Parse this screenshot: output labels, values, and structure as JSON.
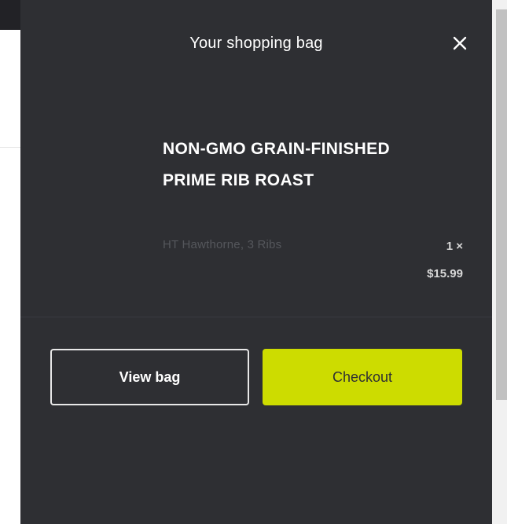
{
  "drawer": {
    "title": "Your shopping bag",
    "close_icon": "close-icon",
    "colors": {
      "background": "#2e2f33",
      "accent": "#cddc00",
      "text": "#ffffff",
      "muted": "#55575c"
    }
  },
  "cart": {
    "items": [
      {
        "name": "NON-GMO GRAIN-FINISHED PRIME RIB ROAST",
        "variant": "HT Hawthorne,  3 Ribs",
        "quantity": "1 ×",
        "price": "$15.99"
      }
    ]
  },
  "actions": {
    "view_bag_label": "View bag",
    "checkout_label": "Checkout"
  }
}
